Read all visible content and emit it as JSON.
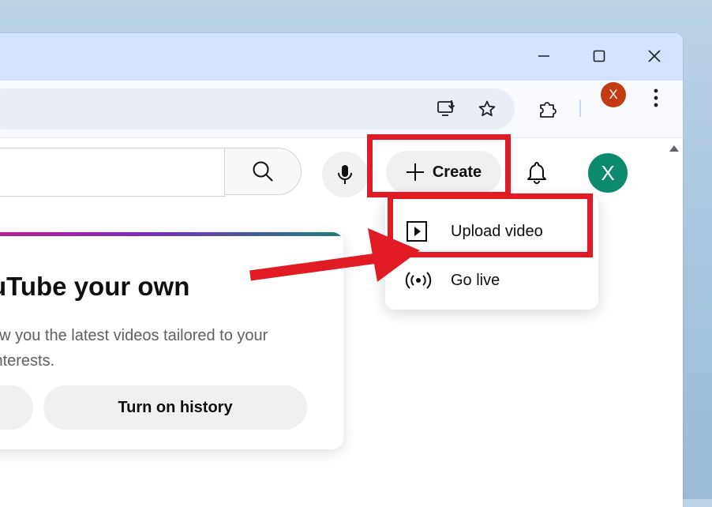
{
  "youtube": {
    "create_label": "Create",
    "avatar_letter": "X",
    "menu": [
      {
        "label": "Upload video",
        "icon": "upload-video-icon"
      },
      {
        "label": "Go live",
        "icon": "broadcast-icon"
      }
    ],
    "card": {
      "title": "uTube your own",
      "text_line1": "ow you the latest videos tailored to your",
      "text_line2": " interests.",
      "history_button": "Turn on history"
    }
  },
  "browser": {
    "profile_letter": "X"
  },
  "colors": {
    "annotation_red": "#e01b24",
    "avatar_green": "#0d8a6d",
    "profile_red": "#c23b12",
    "titlebar": "#d3e3fd"
  }
}
